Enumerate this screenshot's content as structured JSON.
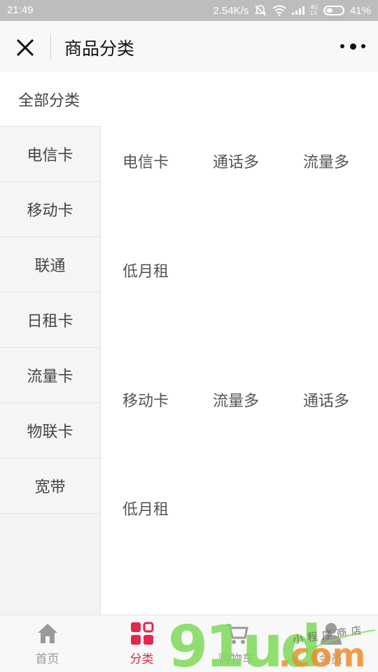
{
  "status_bar": {
    "time": "21:49",
    "speed": "2.54K/s",
    "battery_pct": "41%",
    "net_type_top": "4G",
    "net_type_bottom": "1X"
  },
  "nav": {
    "title": "商品分类"
  },
  "header": {
    "all_categories": "全部分类"
  },
  "sidebar": {
    "items": [
      {
        "label": "电信卡"
      },
      {
        "label": "移动卡"
      },
      {
        "label": "联通"
      },
      {
        "label": "日租卡"
      },
      {
        "label": "流量卡"
      },
      {
        "label": "物联卡"
      },
      {
        "label": "宽带"
      }
    ]
  },
  "content": {
    "cells": [
      {
        "label": "电信卡"
      },
      {
        "label": "通话多"
      },
      {
        "label": "流量多"
      },
      {
        "label": "低月租"
      },
      {
        "label": "移动卡"
      },
      {
        "label": "流量多"
      },
      {
        "label": "通话多"
      },
      {
        "label": "低月租"
      }
    ]
  },
  "tabbar": {
    "tabs": [
      {
        "label": "首页"
      },
      {
        "label": "分类"
      },
      {
        "label": "购物车"
      },
      {
        "label": "会员"
      }
    ]
  },
  "watermark": {
    "brand": "91ud",
    "suffix": ".com",
    "caption": "小程序商店"
  },
  "colors": {
    "accent": "#e0294a",
    "tab_inactive": "#999999",
    "watermark_green": "#7ed957",
    "watermark_orange": "#f08b2a"
  }
}
